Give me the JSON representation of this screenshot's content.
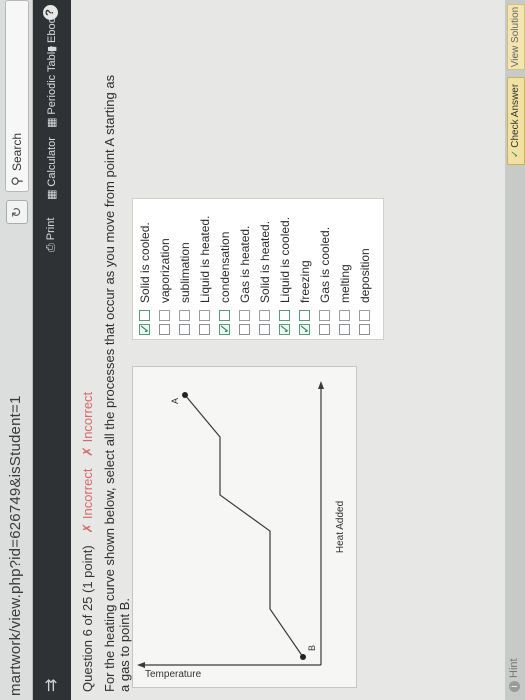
{
  "browser": {
    "url": "martwork/view.php?id=626749&isStudent=1",
    "reload_icon": "reload-icon",
    "search_label": "Search"
  },
  "toolbar": {
    "print": "Print",
    "calculator": "Calculator",
    "periodic_table": "Periodic Table",
    "ebook": "Ebook"
  },
  "question": {
    "header": "Question 6 of 25 (1 point)",
    "status_1": "Incorrect",
    "status_2": "Incorrect",
    "prompt": "For the heating curve shown below, select all the processes that occur as you move from point A starting as a gas to point B."
  },
  "graph": {
    "y_label": "Temperature",
    "x_label": "Heat Added",
    "point_a": "A",
    "point_b": "B"
  },
  "choices": [
    {
      "label": "Solid is cooled.",
      "checked": true
    },
    {
      "label": "vaporization",
      "checked": false
    },
    {
      "label": "sublimation",
      "checked": false
    },
    {
      "label": "Liquid is heated.",
      "checked": false
    },
    {
      "label": "condensation",
      "checked": true
    },
    {
      "label": "Gas is heated.",
      "checked": false
    },
    {
      "label": "Solid is heated.",
      "checked": false
    },
    {
      "label": "Liquid is cooled.",
      "checked": true
    },
    {
      "label": "freezing",
      "checked": true
    },
    {
      "label": "Gas is cooled.",
      "checked": false
    },
    {
      "label": "melting",
      "checked": false
    },
    {
      "label": "deposition",
      "checked": false
    }
  ],
  "footer": {
    "hint": "Hint",
    "check_answer": "Check Answer",
    "view_solution": "View Solution"
  }
}
